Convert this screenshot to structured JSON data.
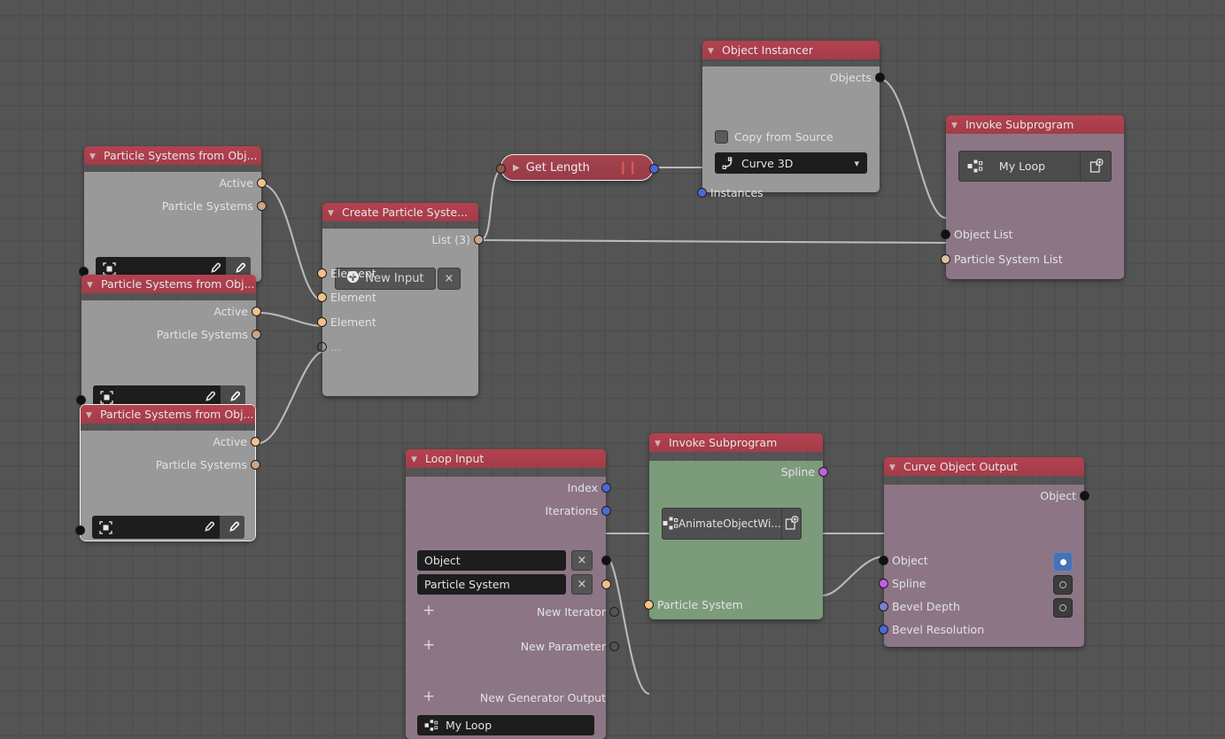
{
  "app": {
    "editor": "node-editor",
    "background_color": "#545454",
    "grid_color": "#4b4b4b"
  },
  "nodes": [
    {
      "id": "psfo1",
      "title": "Particle Systems from Obj...",
      "header_color": "#b5414f",
      "body_color": "#999999",
      "outputs": [
        "Active",
        "Particle Systems"
      ],
      "object_field_value": ""
    },
    {
      "id": "psfo2",
      "title": "Particle Systems from Obj...",
      "header_color": "#b5414f",
      "body_color": "#999999",
      "outputs": [
        "Active",
        "Particle Systems"
      ],
      "object_field_value": ""
    },
    {
      "id": "psfo3",
      "title": "Particle Systems from Obj...",
      "header_color": "#b5414f",
      "body_color": "#999999",
      "outputs": [
        "Active",
        "Particle Systems"
      ],
      "object_field_value": "",
      "selected": true
    },
    {
      "id": "create_particle_system",
      "title": "Create Particle Syste...",
      "header_color": "#b5414f",
      "body_color": "#999999",
      "output_label": "List (3)",
      "new_input_button": "New Input",
      "remove_button": "×",
      "inputs": [
        "Element",
        "Element",
        "Element",
        "..."
      ]
    },
    {
      "id": "get_length",
      "title": "Get Length",
      "collapsed": true,
      "selected": true,
      "header_color": "#a7434f"
    },
    {
      "id": "object_instancer",
      "title": "Object Instancer",
      "header_color": "#b5414f",
      "body_color": "#999999",
      "output_label": "Objects",
      "checkbox_label": "Copy from Source",
      "checkbox_checked": false,
      "dropdown_value": "Curve 3D",
      "input_label": "Instances"
    },
    {
      "id": "invoke_subprogram_1",
      "title": "Invoke Subprogram",
      "header_color": "#b5414f",
      "body_color": "#8c7685",
      "subprogram_name": "My Loop",
      "inputs": [
        "Object List",
        "Particle System List"
      ]
    },
    {
      "id": "loop_input",
      "title": "Loop Input",
      "header_color": "#b5414f",
      "body_color": "#8c7685",
      "outputs": [
        "Index",
        "Iterations"
      ],
      "iterator_fields": [
        "Object",
        "Particle System"
      ],
      "remove_button": "×",
      "new_iterator": "New Iterator",
      "new_parameter": "New Parameter",
      "new_generator_output": "New Generator Output",
      "footer_name": "My Loop"
    },
    {
      "id": "invoke_subprogram_2",
      "title": "Invoke Subprogram",
      "header_color": "#b5414f",
      "body_color": "#7b9b7b",
      "output_label": "Spline",
      "subprogram_name": "AnimateObjectWi...",
      "input_label": "Particle System"
    },
    {
      "id": "curve_object_output",
      "title": "Curve Object Output",
      "header_color": "#b5414f",
      "body_color": "#8c7685",
      "output_label": "Object",
      "inputs": [
        "Object",
        "Spline",
        "Bevel Depth",
        "Bevel Resolution"
      ],
      "toggles": [
        {
          "for": "Spline",
          "state": "on"
        },
        {
          "for": "Bevel Depth",
          "state": "off"
        },
        {
          "for": "Bevel Resolution",
          "state": "off"
        }
      ]
    }
  ],
  "socket_colors": {
    "object": "#111111",
    "particle_system": "#f2c08a",
    "particle_system_list": "#c9a487",
    "integer": "#4a69d4",
    "spline": "#c35ee0",
    "float": "#7b80c9",
    "hollow": "transparent"
  },
  "link_color": "#c8c8c8"
}
